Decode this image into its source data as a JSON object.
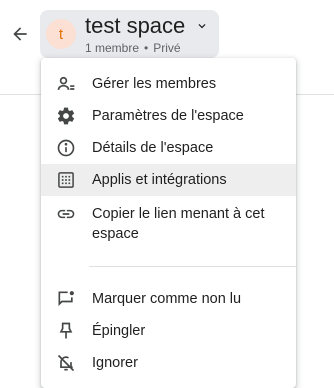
{
  "header": {
    "space_name": "test space",
    "avatar_letter": "t",
    "member_count": "1 membre",
    "separator": "•",
    "visibility": "Privé"
  },
  "menu": {
    "items": [
      {
        "label": "Gérer les membres",
        "icon": "manage-members-icon"
      },
      {
        "label": "Paramètres de l'espace",
        "icon": "gear-icon"
      },
      {
        "label": "Détails de l'espace",
        "icon": "info-icon"
      },
      {
        "label": "Applis et intégrations",
        "icon": "apps-grid-icon"
      },
      {
        "label_line1": "Copier le lien menant à cet",
        "label_line2": "espace",
        "icon": "link-icon"
      },
      {
        "label": "Marquer comme non lu",
        "icon": "mark-unread-icon"
      },
      {
        "label": "Épingler",
        "icon": "pin-icon"
      },
      {
        "label": "Ignorer",
        "icon": "mute-icon"
      }
    ]
  },
  "colors": {
    "avatar_bg": "#fbe0d3",
    "avatar_fg": "#e8710a",
    "chip_bg": "#e8eaed",
    "hover_bg": "#eeeeee"
  }
}
